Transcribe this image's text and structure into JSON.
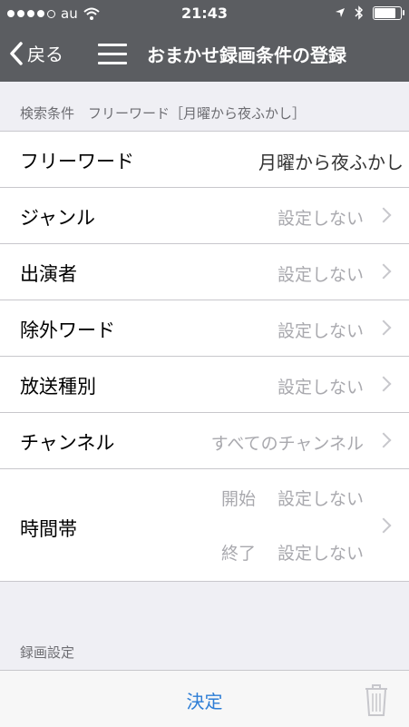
{
  "status": {
    "carrier": "au",
    "time": "21:43",
    "battery_fraction": 0.9
  },
  "nav": {
    "back_label": "戻る",
    "title": "おまかせ録画条件の登録"
  },
  "search": {
    "header": "検索条件　フリーワード［月曜から夜ふかし］"
  },
  "rows": [
    {
      "label": "フリーワード",
      "value": "月曜から夜ふかし"
    },
    {
      "label": "ジャンル",
      "value": "設定しない"
    },
    {
      "label": "出演者",
      "value": "設定しない"
    },
    {
      "label": "除外ワード",
      "value": "設定しない"
    },
    {
      "label": "放送種別",
      "value": "設定しない"
    },
    {
      "label": "チャンネル",
      "value": "すべてのチャンネル"
    }
  ],
  "timeband": {
    "label": "時間帯",
    "start_label": "開始",
    "start_value": "設定しない",
    "end_label": "終了",
    "end_value": "設定しない"
  },
  "record": {
    "header": "録画設定"
  },
  "toolbar": {
    "decide_label": "決定"
  },
  "colors": {
    "bar": "#5b5d61",
    "accent": "#2e7ed6",
    "muted": "#a9a9ae"
  }
}
